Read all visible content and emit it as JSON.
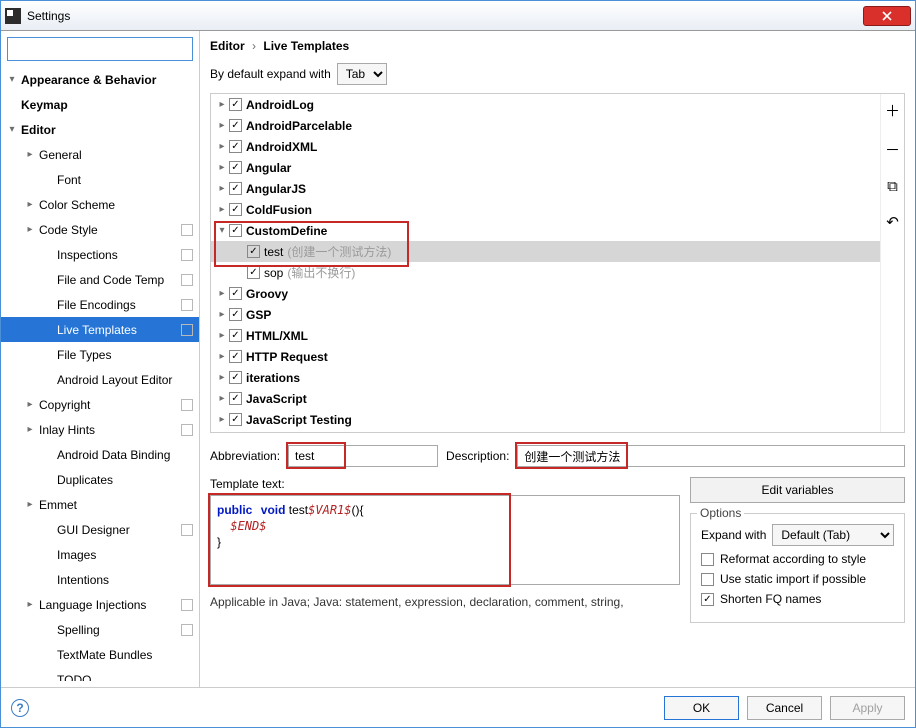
{
  "window": {
    "title": "Settings"
  },
  "search_placeholder": "",
  "sidebar": {
    "items": [
      {
        "label": "Appearance & Behavior",
        "level": 1,
        "arrow": "▾",
        "bold": true
      },
      {
        "label": "Keymap",
        "level": 1,
        "arrow": "",
        "bold": true
      },
      {
        "label": "Editor",
        "level": 1,
        "arrow": "▾",
        "bold": true
      },
      {
        "label": "General",
        "level": 2,
        "arrow": "▸"
      },
      {
        "label": "Font",
        "level": 3,
        "arrow": ""
      },
      {
        "label": "Color Scheme",
        "level": 2,
        "arrow": "▸"
      },
      {
        "label": "Code Style",
        "level": 2,
        "arrow": "▸",
        "badge": true
      },
      {
        "label": "Inspections",
        "level": 3,
        "arrow": "",
        "badge": true
      },
      {
        "label": "File and Code Temp",
        "level": 3,
        "arrow": "",
        "badge": true
      },
      {
        "label": "File Encodings",
        "level": 3,
        "arrow": "",
        "badge": true
      },
      {
        "label": "Live Templates",
        "level": 3,
        "arrow": "",
        "badge": true,
        "sel": true
      },
      {
        "label": "File Types",
        "level": 3,
        "arrow": ""
      },
      {
        "label": "Android Layout Editor",
        "level": 3,
        "arrow": ""
      },
      {
        "label": "Copyright",
        "level": 2,
        "arrow": "▸",
        "badge": true
      },
      {
        "label": "Inlay Hints",
        "level": 2,
        "arrow": "▸",
        "badge": true
      },
      {
        "label": "Android Data Binding",
        "level": 3,
        "arrow": ""
      },
      {
        "label": "Duplicates",
        "level": 3,
        "arrow": ""
      },
      {
        "label": "Emmet",
        "level": 2,
        "arrow": "▸"
      },
      {
        "label": "GUI Designer",
        "level": 3,
        "arrow": "",
        "badge": true
      },
      {
        "label": "Images",
        "level": 3,
        "arrow": ""
      },
      {
        "label": "Intentions",
        "level": 3,
        "arrow": ""
      },
      {
        "label": "Language Injections",
        "level": 2,
        "arrow": "▸",
        "badge": true
      },
      {
        "label": "Spelling",
        "level": 3,
        "arrow": "",
        "badge": true
      },
      {
        "label": "TextMate Bundles",
        "level": 3,
        "arrow": ""
      },
      {
        "label": "TODO",
        "level": 3,
        "arrow": ""
      }
    ]
  },
  "breadcrumb": {
    "a": "Editor",
    "b": "Live Templates"
  },
  "expand": {
    "label": "By default expand with",
    "value": "Tab"
  },
  "templates": [
    {
      "label": "AndroidLog",
      "arrow": "▸",
      "checked": true
    },
    {
      "label": "AndroidParcelable",
      "arrow": "▸",
      "checked": true
    },
    {
      "label": "AndroidXML",
      "arrow": "▸",
      "checked": true
    },
    {
      "label": "Angular",
      "arrow": "▸",
      "checked": true
    },
    {
      "label": "AngularJS",
      "arrow": "▸",
      "checked": true
    },
    {
      "label": "ColdFusion",
      "arrow": "▸",
      "checked": true
    },
    {
      "label": "CustomDefine",
      "arrow": "▾",
      "checked": true,
      "hl": true,
      "children": [
        {
          "label": "test",
          "hint": "(创建一个测试方法)",
          "checked": true,
          "sel": true
        },
        {
          "label": "sop",
          "hint": "(输出不换行)",
          "checked": true
        }
      ]
    },
    {
      "label": "Groovy",
      "arrow": "▸",
      "checked": true
    },
    {
      "label": "GSP",
      "arrow": "▸",
      "checked": true
    },
    {
      "label": "HTML/XML",
      "arrow": "▸",
      "checked": true
    },
    {
      "label": "HTTP Request",
      "arrow": "▸",
      "checked": true
    },
    {
      "label": "iterations",
      "arrow": "▸",
      "checked": true
    },
    {
      "label": "JavaScript",
      "arrow": "▸",
      "checked": true
    },
    {
      "label": "JavaScript Testing",
      "arrow": "▸",
      "checked": true
    }
  ],
  "form": {
    "abbr_label": "Abbreviation:",
    "abbr_value": "test",
    "desc_label": "Description:",
    "desc_value": "创建一个测试方法",
    "template_label": "Template text:",
    "code_kw1": "public",
    "code_kw2": "void",
    "code_plain1": " test",
    "code_var1": "$VAR1$",
    "code_plain2": "(){",
    "code_indent": "    ",
    "code_var2": "$END$",
    "code_close": "}",
    "edit_vars": "Edit variables",
    "opts_title": "Options",
    "expand_with_label": "Expand with",
    "expand_with_value": "Default (Tab)",
    "opt1": "Reformat according to style",
    "opt2": "Use static import if possible",
    "opt3": "Shorten FQ names",
    "applicable": "Applicable in Java; Java: statement, expression, declaration, comment, string,"
  },
  "footer": {
    "ok": "OK",
    "cancel": "Cancel",
    "apply": "Apply"
  }
}
